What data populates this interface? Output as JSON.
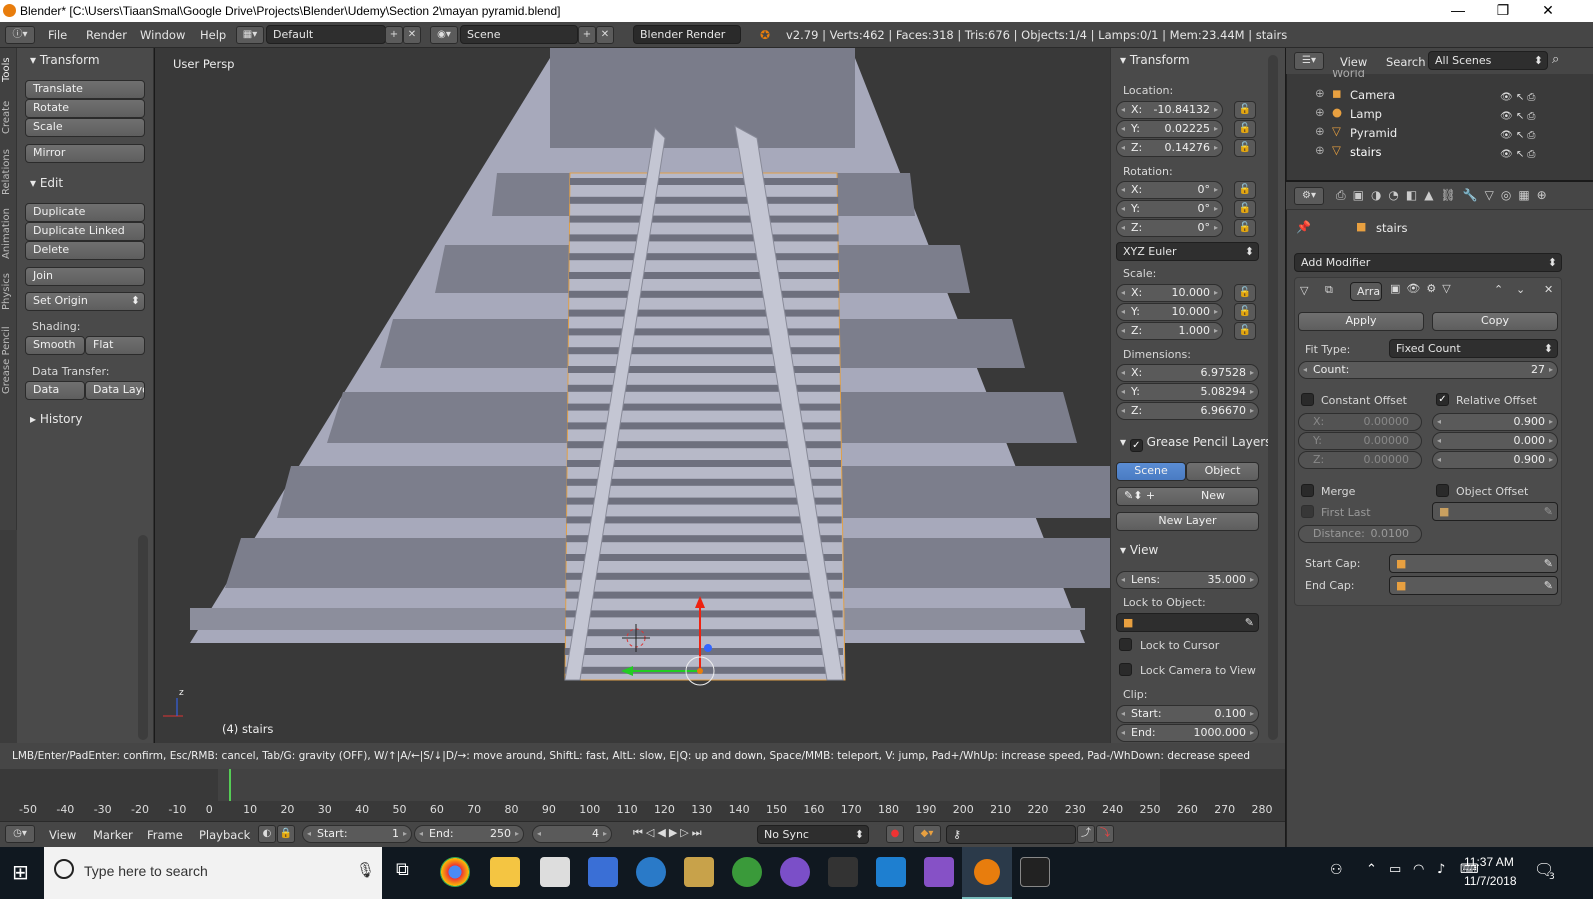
{
  "window": {
    "title": "Blender* [C:\\Users\\TiaanSmal\\Google Drive\\Projects\\Blender\\Udemy\\Section 2\\mayan pyramid.blend]",
    "minimize": "—",
    "maximize": "❐",
    "close": "✕"
  },
  "infobar": {
    "menus": [
      "File",
      "Render",
      "Window",
      "Help"
    ],
    "layout": "Default",
    "scene": "Scene",
    "engine": "Blender Render",
    "stats": "v2.79 | Verts:462 | Faces:318 | Tris:676 | Objects:1/4 | Lamps:0/1 | Mem:23.44M | stairs"
  },
  "toolshelf": {
    "tabs": [
      "Tools",
      "Create",
      "Relations",
      "Animation",
      "Physics",
      "Grease Pencil"
    ],
    "transform_header": "Transform",
    "translate": "Translate",
    "rotate": "Rotate",
    "scale": "Scale",
    "mirror": "Mirror",
    "edit_header": "Edit",
    "duplicate": "Duplicate",
    "duplicate_linked": "Duplicate Linked",
    "delete": "Delete",
    "join": "Join",
    "set_origin": "Set Origin",
    "shading_label": "Shading:",
    "smooth": "Smooth",
    "flat": "Flat",
    "data_transfer_label": "Data Transfer:",
    "data": "Data",
    "data_layout": "Data Layo",
    "history_header": "History"
  },
  "viewport": {
    "view_label": "User Persp",
    "object_label": "(4) stairs",
    "axis_x": "",
    "axis_z": "z"
  },
  "npanel": {
    "transform_header": "Transform",
    "location_label": "Location:",
    "location": {
      "x": "-10.84132",
      "y": "0.02225",
      "z": "0.14276"
    },
    "rotation_label": "Rotation:",
    "rotation": {
      "x": "0°",
      "y": "0°",
      "z": "0°"
    },
    "rotation_mode": "XYZ Euler",
    "scale_label": "Scale:",
    "scale": {
      "x": "10.000",
      "y": "10.000",
      "z": "1.000"
    },
    "dimensions_label": "Dimensions:",
    "dimensions": {
      "x": "6.97528",
      "y": "5.08294",
      "z": "6.96670"
    },
    "gp_header": "Grease Pencil Layers",
    "scene_btn": "Scene",
    "object_btn": "Object",
    "new_btn": "New",
    "new_layer_btn": "New Layer",
    "view_header": "View",
    "lens_label": "Lens:",
    "lens_value": "35.000",
    "lock_to_object": "Lock to Object:",
    "lock_to_cursor": "Lock to Cursor",
    "lock_camera": "Lock Camera to View",
    "clip_label": "Clip:",
    "clip_start_label": "Start:",
    "clip_start": "0.100",
    "clip_end_label": "End:",
    "clip_end": "1000.000"
  },
  "outliner": {
    "view": "View",
    "search": "Search",
    "scenes": "All Scenes",
    "items": [
      {
        "name": "World"
      },
      {
        "name": "Camera"
      },
      {
        "name": "Lamp"
      },
      {
        "name": "Pyramid"
      },
      {
        "name": "stairs"
      }
    ]
  },
  "properties": {
    "object_name": "stairs",
    "add_modifier": "Add Modifier",
    "modifier_name": "Arra",
    "apply": "Apply",
    "copy": "Copy",
    "fit_type_label": "Fit Type:",
    "fit_type": "Fixed Count",
    "count_label": "Count:",
    "count": "27",
    "constant_offset": "Constant Offset",
    "relative_offset": "Relative Offset",
    "const": {
      "x": "0.00000",
      "y": "0.00000",
      "z": "0.00000"
    },
    "rel": {
      "x": "0.900",
      "y": "0.000",
      "z": "0.900"
    },
    "merge": "Merge",
    "object_offset": "Object Offset",
    "first_last": "First Last",
    "distance_label": "Distance:",
    "distance": "0.0100",
    "start_cap": "Start Cap:",
    "end_cap": "End Cap:"
  },
  "status": {
    "hint": "LMB/Enter/PadEnter: confirm, Esc/RMB: cancel, Tab/G: gravity (OFF), W/↑|A/←|S/↓|D/→: move around, ShiftL: fast, AltL: slow, E|Q: up and down, Space/MMB: teleport, V: jump, Pad+/WhUp: increase speed, Pad-/WhDown: decrease speed"
  },
  "timeline": {
    "ticks": [
      "-50",
      "-40",
      "-30",
      "-20",
      "-10",
      "0",
      "10",
      "20",
      "30",
      "40",
      "50",
      "60",
      "70",
      "80",
      "90",
      "100",
      "110",
      "120",
      "130",
      "140",
      "150",
      "160",
      "170",
      "180",
      "190",
      "200",
      "210",
      "220",
      "230",
      "240",
      "250",
      "260",
      "270",
      "280"
    ],
    "current_frame_marker": 4,
    "menus": [
      "View",
      "Marker",
      "Frame",
      "Playback"
    ],
    "start_label": "Start:",
    "start": "1",
    "end_label": "End:",
    "end": "250",
    "current": "4",
    "sync": "No Sync"
  },
  "taskbar": {
    "search_placeholder": "Type here to search",
    "time": "11:37 AM",
    "date": "11/7/2018",
    "notif_count": "3"
  },
  "colors": {
    "accent_orange": "#e87d0d",
    "selection_blue": "#5b8dd4",
    "pyramid_face": "#aeb0c0",
    "panel_bg": "#4a4a4a"
  }
}
